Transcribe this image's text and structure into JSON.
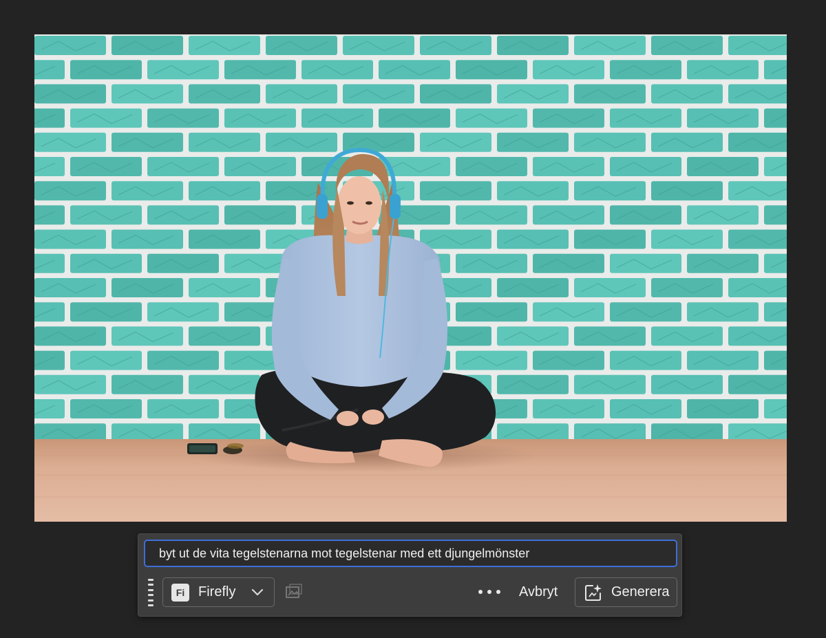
{
  "prompt": {
    "value": "byt ut de vita tegelstenarna mot tegelstenar med ett djungelmönster"
  },
  "model_picker": {
    "badge": "Fi",
    "label": "Firefly"
  },
  "actions": {
    "cancel_label": "Avbryt",
    "generate_label": "Generera"
  },
  "icons": {
    "grip": "drag-handle-icon",
    "model_dropdown": "chevron-down-icon",
    "reference_image": "reference-image-icon",
    "more": "more-options-icon",
    "generate": "generative-sparkle-icon"
  },
  "colors": {
    "app_background": "#232323",
    "taskbar_background": "#3d3d3d",
    "input_focus_border": "#3e6fd8",
    "brick_teal": "#53bdb1",
    "mortar": "#e9ecea",
    "floor_wood": "#d7a98c"
  }
}
